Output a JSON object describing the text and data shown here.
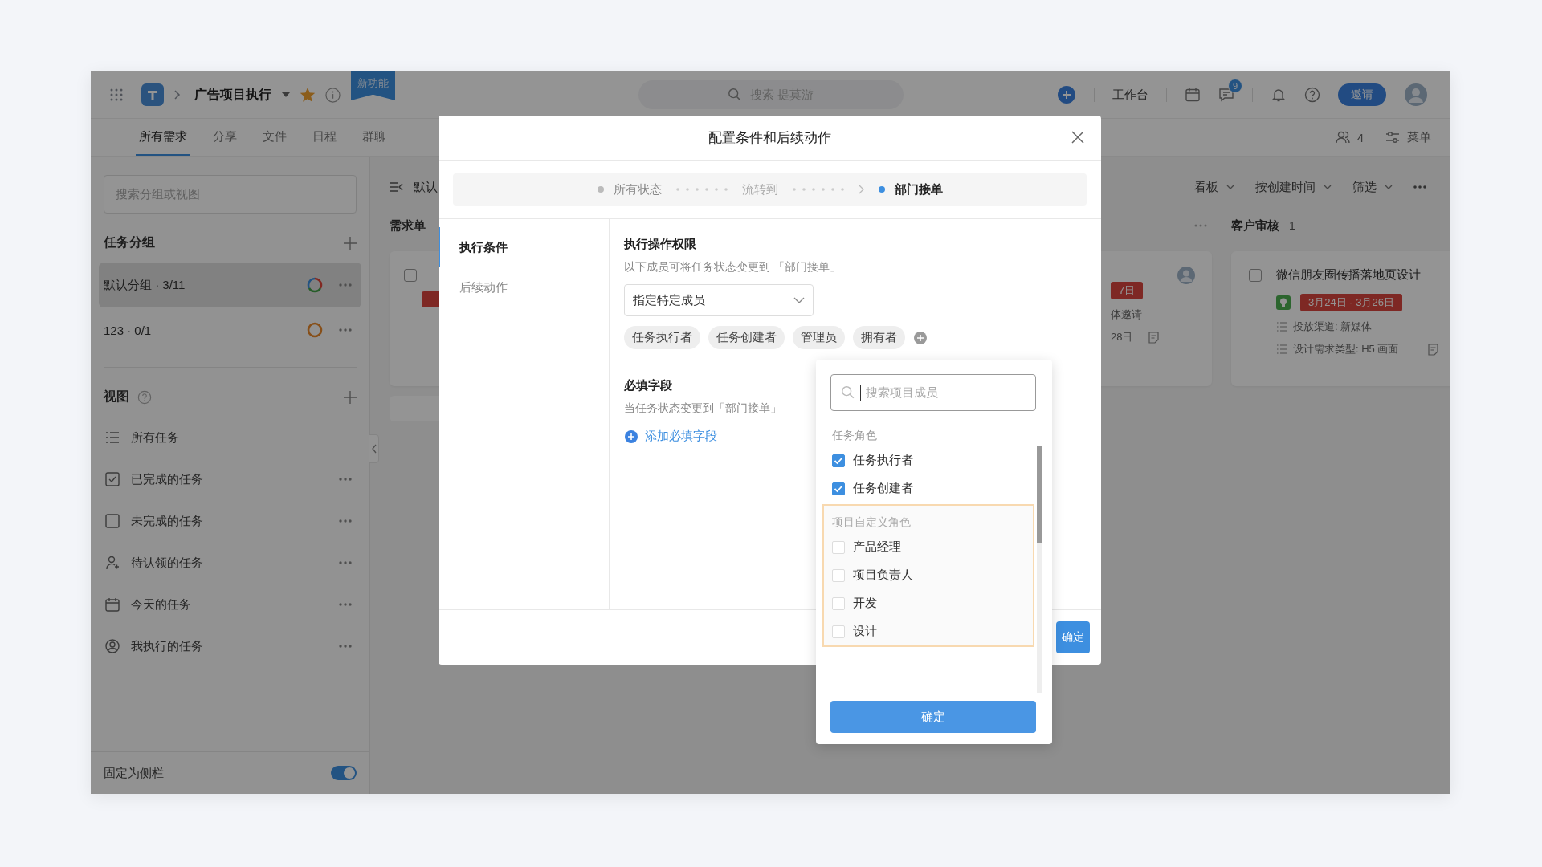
{
  "topbar": {
    "project": "广告项目执行",
    "starred": true,
    "badge": "新功能",
    "search_placeholder": "搜索 提莫游",
    "workbench": "工作台",
    "message_count": "9",
    "invite": "邀请"
  },
  "tabs": [
    {
      "label": "所有需求",
      "selected": true
    },
    {
      "label": "分享",
      "selected": false
    },
    {
      "label": "文件",
      "selected": false
    },
    {
      "label": "日程",
      "selected": false
    },
    {
      "label": "群聊",
      "selected": false
    }
  ],
  "tab_actions": {
    "member_count": "4",
    "menu": "菜单"
  },
  "sidebar": {
    "search_placeholder": "搜索分组或视图",
    "groups_title": "任务分组",
    "groups": [
      {
        "label": "默认分组 · 3/11",
        "selected": true,
        "kind": "mixed"
      },
      {
        "label": "123 · 0/1",
        "selected": false,
        "kind": "pending"
      }
    ],
    "views_title": "视图",
    "views": [
      {
        "label": "所有任务",
        "kind": "list",
        "more": false
      },
      {
        "label": "已完成的任务",
        "kind": "done",
        "more": true
      },
      {
        "label": "未完成的任务",
        "kind": "todo",
        "more": true
      },
      {
        "label": "待认领的任务",
        "kind": "claim",
        "more": true
      },
      {
        "label": "今天的任务",
        "kind": "today",
        "more": true
      },
      {
        "label": "我执行的任务",
        "kind": "mine",
        "more": true
      }
    ],
    "pin": {
      "label": "固定为侧栏",
      "on": true
    }
  },
  "board": {
    "view_label": "默认",
    "toolbar": [
      "看板",
      "按创建时间",
      "筛选"
    ],
    "column_1": {
      "title": "需求单",
      "checked": false
    },
    "column_2": {
      "tag": "7日",
      "field": "体邀请",
      "date": "28日"
    },
    "column_3": {
      "title": "客户审核",
      "count": "1",
      "card": {
        "title": "微信朋友圈传播落地页设计",
        "checked": false,
        "date": "3月24日 - 3月26日",
        "fields": [
          "投放渠道: 新媒体",
          "设计需求类型: H5 画面"
        ]
      }
    }
  },
  "modal": {
    "title": "配置条件和后续动作",
    "steps": [
      {
        "label": "所有状态",
        "kind": "status",
        "active": false
      },
      {
        "label": "流转到",
        "kind": "transition"
      },
      {
        "label": "部门接单",
        "kind": "status",
        "active": true
      }
    ],
    "nav": [
      {
        "label": "执行条件",
        "selected": true
      },
      {
        "label": "后续动作",
        "selected": false
      }
    ],
    "permission": {
      "title": "执行操作权限",
      "description": "以下成员可将任务状态变更到 「部门接单」",
      "select_value": "指定特定成员",
      "tags": [
        "任务执行者",
        "任务创建者",
        "管理员",
        "拥有者"
      ]
    },
    "required": {
      "title": "必填字段",
      "description": "当任务状态变更到「部门接单」",
      "add_link": "添加必填字段"
    },
    "confirm": "确定"
  },
  "dropdown": {
    "search_placeholder": "搜索项目成员",
    "sections": [
      {
        "title": "任务角色",
        "highlighted": false,
        "items": [
          {
            "label": "任务执行者",
            "checked": true
          },
          {
            "label": "任务创建者",
            "checked": true
          }
        ]
      },
      {
        "title": "项目自定义角色",
        "highlighted": true,
        "items": [
          {
            "label": "产品经理",
            "checked": false
          },
          {
            "label": "项目负责人",
            "checked": false
          },
          {
            "label": "开发",
            "checked": false
          },
          {
            "label": "设计",
            "checked": false
          }
        ]
      }
    ],
    "confirm": "确定"
  }
}
